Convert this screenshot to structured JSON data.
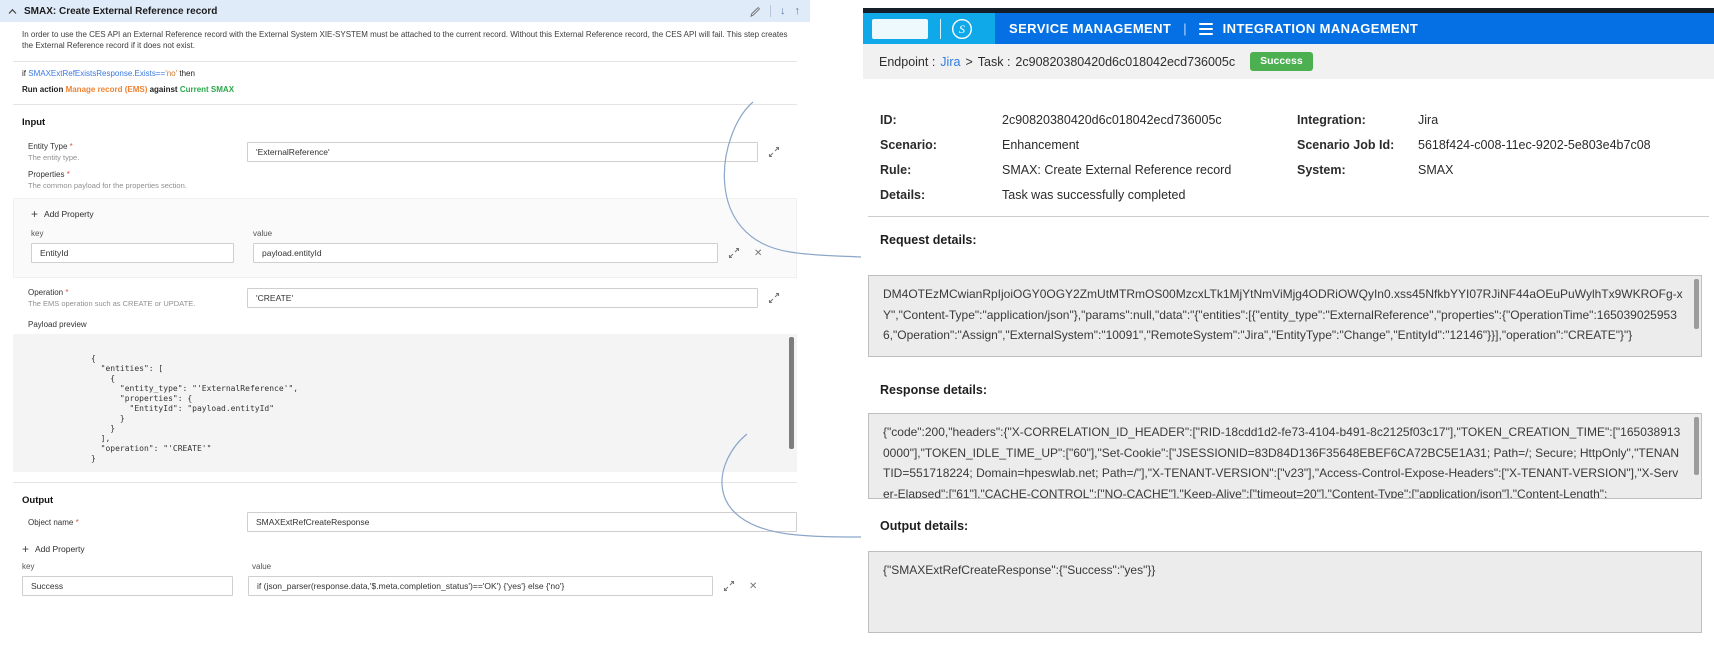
{
  "left_panel": {
    "header": {
      "title": "SMAX: Create External Reference record",
      "move_down_icon": "↓",
      "move_up_icon": "↑"
    },
    "description": "In order to use the CES API an External Reference record with the External System XIE-SYSTEM must be attached to the current record. Without this External Reference record, the CES API will fail. This step creates the External Reference record if it does not exist.",
    "condition": {
      "prefix": "if ",
      "expression": "SMAXExtRefExistsResponse.Exists==",
      "value": "'no'",
      "suffix": " then"
    },
    "run_action": {
      "prefix": "Run action ",
      "action": "Manage record (EMS)",
      "middle": " against ",
      "target": "Current SMAX"
    },
    "input_section": {
      "title": "Input",
      "entity_type": {
        "label": "Entity Type ",
        "required": "*",
        "hint": "The entity type.",
        "value": "'ExternalReference'"
      },
      "properties": {
        "label": "Properties ",
        "required": "*",
        "hint": "The common payload for the properties section.",
        "add_button": "Add Property",
        "add_icon": "+",
        "key_header": "key",
        "value_header": "value",
        "rows": [
          {
            "key": "EntityId",
            "value": "payload.entityId",
            "close_icon": "✕"
          }
        ]
      },
      "operation": {
        "label": "Operation ",
        "required": "*",
        "hint": "The EMS operation such as CREATE or UPDATE.",
        "value": "'CREATE'"
      },
      "payload_preview": {
        "label": "Payload preview",
        "code": "{\n  \"entities\": [\n    {\n      \"entity_type\": \"'ExternalReference'\",\n      \"properties\": {\n        \"EntityId\": \"payload.entityId\"\n      }\n    }\n  ],\n  \"operation\": \"'CREATE'\"\n}"
      }
    },
    "output_section": {
      "title": "Output",
      "object_name": {
        "label": "Object name ",
        "required": "*",
        "value": "SMAXExtRefCreateResponse"
      },
      "add_button": "Add Property",
      "add_icon": "+",
      "key_header": "key",
      "value_header": "value",
      "rows": [
        {
          "key": "Success",
          "value": "if (json_parser(response.data,'$.meta.completion_status')=='OK') {'yes'} else {'no'}",
          "close_icon": "✕"
        }
      ]
    }
  },
  "right_panel": {
    "header": {
      "brand_left": "SERVICE MANAGEMENT",
      "brand_divider": "|",
      "brand_right": "INTEGRATION MANAGEMENT",
      "logo_letter": "S"
    },
    "breadcrumb": {
      "endpoint_label": "Endpoint :",
      "endpoint_value": "Jira",
      "separator": ">",
      "task_label": "Task :",
      "task_value": "2c90820380420d6c018042ecd736005c",
      "status_badge": "Success"
    },
    "details": {
      "id_label": "ID:",
      "id_value": "2c90820380420d6c018042ecd736005c",
      "integration_label": "Integration:",
      "integration_value": "Jira",
      "scenario_label": "Scenario:",
      "scenario_value": "Enhancement",
      "scenario_job_id_label": "Scenario Job Id:",
      "scenario_job_id_value": "5618f424-c008-11ec-9202-5e803e4b7c08",
      "rule_label": "Rule:",
      "rule_value": "SMAX: Create External Reference record",
      "system_label": "System:",
      "system_value": "SMAX",
      "details_label": "Details:",
      "details_value": "Task was successfully completed"
    },
    "request_details": {
      "title": "Request details:",
      "content": "DM4OTEzMCwianRpIjoiOGY0OGY2ZmUtMTRmOS00MzcxLTk1MjYtNmViMjg4ODRiOWQyIn0.xss45NfkbYYI07RJiNF44aOEuPuWylhTx9WKROFg-xY\",\"Content-Type\":\"application/json\"},\"params\":null,\"data\":\"{\"entities\":[{\"entity_type\":\"ExternalReference\",\"properties\":{\"OperationTime\":1650390259536,\"Operation\":\"Assign\",\"ExternalSystem\":\"10091\",\"RemoteSystem\":\"Jira\",\"EntityType\":\"Change\",\"EntityId\":\"12146\"}}],\"operation\":\"CREATE\"}\"}"
    },
    "response_details": {
      "title": "Response details:",
      "content": "{\"code\":200,\"headers\":{\"X-CORRELATION_ID_HEADER\":[\"RID-18cdd1d2-fe73-4104-b491-8c2125f03c17\"],\"TOKEN_CREATION_TIME\":[\"1650389130000\"],\"TOKEN_IDLE_TIME_UP\":[\"60\"],\"Set-Cookie\":[\"JSESSIONID=83D84D136F35648EBEF6CA72BC5E1A31; Path=/; Secure; HttpOnly\",\"TENANTID=551718224; Domain=hpeswlab.net; Path=/\"],\"X-TENANT-VERSION\":[\"v23\"],\"Access-Control-Expose-Headers\":[\"X-TENANT-VERSION\"],\"X-Server-Elapsed\":[\"61\"],\"CACHE-CONTROL\":[\"NO-CACHE\"],\"Keep-Alive\":[\"timeout=20\"],\"Content-Type\":[\"application/json\"],\"Content-Length\":"
    },
    "output_details": {
      "title": "Output details:",
      "content": "{\"SMAXExtRefCreateResponse\":{\"Success\":\"yes\"}}"
    }
  },
  "colors": {
    "panel_header_blue": "#e0ebf9",
    "brand_cyan": "#0fa8e9",
    "brand_blue": "#0470e4",
    "topbar_dark": "#141e28",
    "success_green": "#4caf50",
    "link_blue": "#2f7ce0",
    "action_orange": "#ee8434",
    "target_green": "#2ba84a",
    "required_red": "#e0544a",
    "detail_box_gray": "#ececec"
  }
}
